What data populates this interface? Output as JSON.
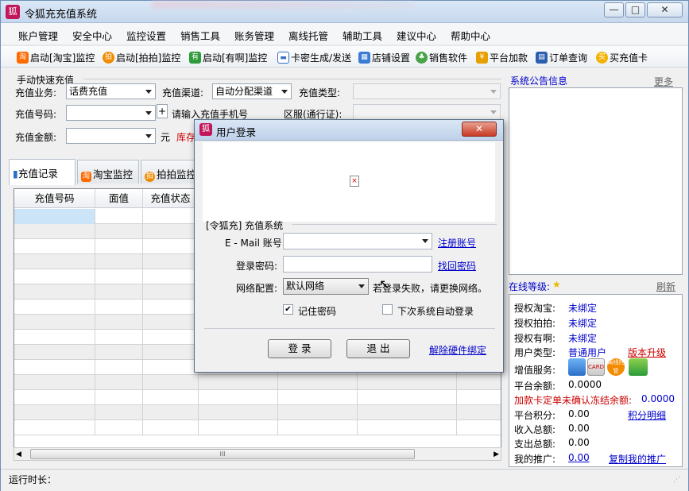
{
  "window": {
    "title": "令狐充充值系统",
    "minimize": "—",
    "maximize": "□",
    "close": "✕"
  },
  "menu": [
    "账户管理",
    "安全中心",
    "监控设置",
    "销售工具",
    "账务管理",
    "离线托管",
    "辅助工具",
    "建议中心",
    "帮助中心"
  ],
  "toolbar": {
    "taobao": "启动[淘宝]监控",
    "paipai": "启动[拍拍]监控",
    "youa": "启动[有啊]监控",
    "card": "卡密生成/发送",
    "shop": "店铺设置",
    "sales": "销售软件",
    "addfund": "平台加款",
    "orders": "订单查询",
    "buycard": "买充值卡"
  },
  "quick": {
    "group": "手动快速充值",
    "business_label": "充值业务:",
    "business_value": "话费充值",
    "channel_label": "充值渠道:",
    "channel_value": "自动分配渠道",
    "type_label": "充值类型:",
    "number_label": "充值号码:",
    "number_hint": "请输入充值手机号",
    "plus": "+",
    "region_label": "区服(通行证):",
    "amount_label": "充值金额:",
    "unit": "元",
    "stock": "库存"
  },
  "tabs": [
    "充值记录",
    "淘宝监控",
    "拍拍监控"
  ],
  "grid": {
    "headers": [
      "充值号码",
      "面值",
      "充值状态"
    ],
    "rows": 15,
    "scroll_grip": "III"
  },
  "status": {
    "runtime_label": "运行时长："
  },
  "notice": {
    "title": "系统公告信息",
    "more": "更多"
  },
  "account": {
    "level_label": "在线等级:",
    "refresh": "刷新",
    "taobao_label": "授权淘宝:",
    "taobao_value": "未绑定",
    "paipai_label": "授权拍拍:",
    "paipai_value": "未绑定",
    "youa_label": "授权有啊:",
    "youa_value": "未绑定",
    "usertype_label": "用户类型:",
    "usertype_value": "普通用户",
    "upgrade": "版本升级",
    "vas_label": "增值服务:",
    "balance_label": "平台余额:",
    "balance_value": "0.0000",
    "frozen_label": "加款卡定单未确认冻结余额:",
    "frozen_value": "0.0000",
    "points_label": "平台积分:",
    "points_value": "0.00",
    "points_link": "积分明细",
    "income_label": "收入总额:",
    "income_value": "0.00",
    "expense_label": "支出总额:",
    "expense_value": "0.00",
    "promo_label": "我的推广:",
    "promo_value": "0.00",
    "promo_link": "复制我的推广"
  },
  "login": {
    "title": "用户登录",
    "close": "✕",
    "broken_image": "×",
    "group": "[令狐充] 充值系统",
    "email_label": "E - Mail 账号:",
    "register": "注册账号",
    "password_label": "登录密码:",
    "recover": "找回密码",
    "network_label": "网络配置:",
    "network_value": "默认网络",
    "network_hint": "若登录失败，请更换网络。",
    "remember": "记住密码",
    "remember_checked": true,
    "autologin": "下次系统自动登录",
    "login_btn": "登 录",
    "exit_btn": "退 出",
    "unbind": "解除硬件绑定"
  }
}
